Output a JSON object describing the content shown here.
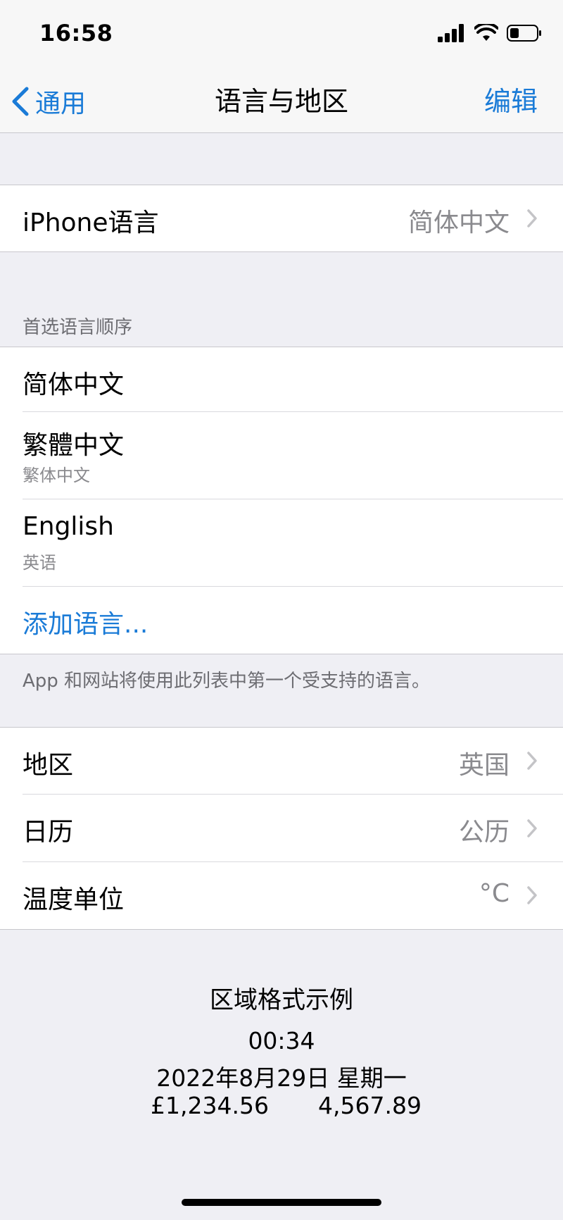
{
  "status_bar": {
    "time": "16:58"
  },
  "nav": {
    "back_label": "通用",
    "title": "语言与地区",
    "edit_label": "编辑"
  },
  "iphone_language": {
    "label": "iPhone语言",
    "value": "简体中文"
  },
  "preferred": {
    "header": "首选语言顺序",
    "languages": [
      {
        "name": "简体中文",
        "sub": ""
      },
      {
        "name": "繁體中文",
        "sub": "繁体中文"
      },
      {
        "name": "English",
        "sub": "英语"
      }
    ],
    "add_label": "添加语言...",
    "footer": "App 和网站将使用此列表中第一个受支持的语言。"
  },
  "region_settings": [
    {
      "label": "地区",
      "value": "英国"
    },
    {
      "label": "日历",
      "value": "公历"
    },
    {
      "label": "温度单位",
      "value": "°C"
    }
  ],
  "format_example": {
    "title": "区域格式示例",
    "time": "00:34",
    "date": "2022年8月29日 星期一",
    "currency": "£1,234.56",
    "number": "4,567.89"
  },
  "colors": {
    "accent": "#1a7bd7",
    "background": "#efeff4"
  }
}
